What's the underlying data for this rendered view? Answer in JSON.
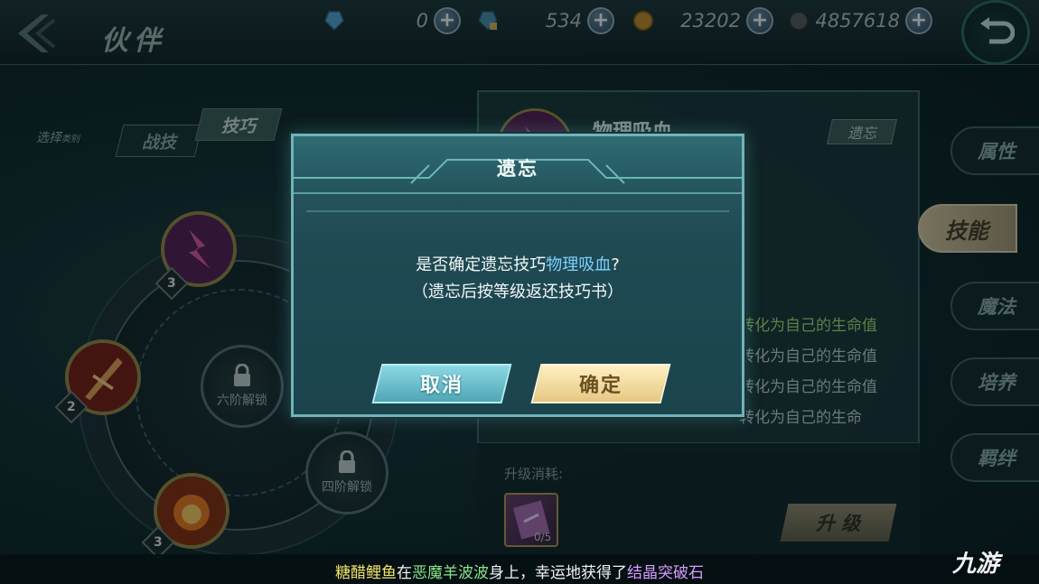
{
  "header": {
    "title": "伙伴",
    "currencies": [
      {
        "icon": "blue-gem-icon",
        "value": "0"
      },
      {
        "icon": "locked-gem-icon",
        "value": "534"
      },
      {
        "icon": "gold-coin-icon",
        "value": "23202"
      },
      {
        "icon": "silver-coin-icon",
        "value": "4857618"
      }
    ]
  },
  "category": {
    "label": "选择",
    "label_small": "类别",
    "tabs": [
      {
        "label": "战技",
        "active": false
      },
      {
        "label": "技巧",
        "active": true
      }
    ]
  },
  "skill_tree": {
    "nodes": [
      {
        "name": "lightning-skill",
        "level": "3"
      },
      {
        "name": "blade-skill",
        "level": "2"
      },
      {
        "name": "fire-skill",
        "level": "3"
      }
    ],
    "locked": [
      {
        "label": "六阶解锁"
      },
      {
        "label": "四阶解锁"
      }
    ]
  },
  "skill_info": {
    "name": "物理吸血",
    "forget_label": "遗忘",
    "desc_lines": [
      "转化为自己的生命值",
      "转化为自己的生命值",
      "转化为自己的生命值",
      "转化为自己的生命"
    ],
    "upgrade_cost_label": "升级消耗:",
    "book_count": "0/5",
    "upgrade_button": "升 级"
  },
  "side_tabs": [
    {
      "label": "属性",
      "active": false
    },
    {
      "label": "技能",
      "active": true
    },
    {
      "label": "魔法",
      "active": false
    },
    {
      "label": "培养",
      "active": false
    },
    {
      "label": "羁绊",
      "active": false
    }
  ],
  "dialog": {
    "title": "遗忘",
    "msg_prefix": "是否确定遗忘技巧",
    "msg_highlight": "物理吸血",
    "msg_suffix": "?",
    "sub": "（遗忘后按等级返还技巧书）",
    "cancel": "取消",
    "confirm": "确定"
  },
  "ticker": {
    "part1": "糖醋鲤鱼",
    "part2": "在",
    "part3": "恶魔羊波波",
    "part4": "身上，幸运地获得了",
    "part5": "结晶突破石"
  },
  "watermark": "九游",
  "colors": {
    "accent_cyan": "#6fb4b8",
    "highlight_blue": "#7fd0ff",
    "confirm_gold": "#e6c783",
    "ticker_yellow": "#f3e46a",
    "ticker_green": "#8be38a",
    "ticker_purple": "#d99bff"
  }
}
